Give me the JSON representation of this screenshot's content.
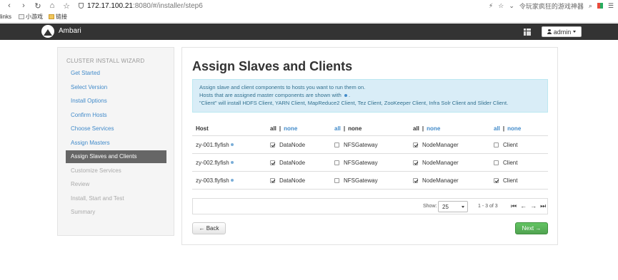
{
  "browser": {
    "back": "‹",
    "forward": "›",
    "reload": "↻",
    "home": "⌂",
    "star": "☆",
    "address_host": "172.17.100.21",
    "address_path": ":8080/#/installer/step6",
    "search_text": "令玩家疯狂的游戏神器"
  },
  "bookmarks": {
    "links_label": "links",
    "items": [
      "小游戏",
      "链接"
    ]
  },
  "header": {
    "brand": "Ambari",
    "user": "admin"
  },
  "sidebar": {
    "title": "CLUSTER INSTALL WIZARD",
    "items": [
      {
        "label": "Get Started",
        "state": "link"
      },
      {
        "label": "Select Version",
        "state": "link"
      },
      {
        "label": "Install Options",
        "state": "link"
      },
      {
        "label": "Confirm Hosts",
        "state": "link"
      },
      {
        "label": "Choose Services",
        "state": "link"
      },
      {
        "label": "Assign Masters",
        "state": "link"
      },
      {
        "label": "Assign Slaves and Clients",
        "state": "active"
      },
      {
        "label": "Customize Services",
        "state": "disabled"
      },
      {
        "label": "Review",
        "state": "disabled"
      },
      {
        "label": "Install, Start and Test",
        "state": "disabled"
      },
      {
        "label": "Summary",
        "state": "disabled"
      }
    ]
  },
  "main": {
    "title": "Assign Slaves and Clients",
    "info_line1": "Assign slave and client components to hosts you want to run them on.",
    "info_line2_a": "Hosts that are assigned master components are shown with",
    "info_line2_b": ".",
    "info_line3": "\"Client\" will install HDFS Client, YARN Client, MapReduce2 Client, Tez Client, ZooKeeper Client, Infra Solr Client and Slider Client.",
    "table": {
      "host_header": "Host",
      "all_label": "all",
      "none_label": "none",
      "sep": "|",
      "rows": [
        {
          "host": "zy-001.flyfish",
          "cells": [
            {
              "label": "DataNode",
              "checked": true
            },
            {
              "label": "NFSGateway",
              "checked": false
            },
            {
              "label": "NodeManager",
              "checked": true
            },
            {
              "label": "Client",
              "checked": false
            }
          ]
        },
        {
          "host": "zy-002.flyfish",
          "cells": [
            {
              "label": "DataNode",
              "checked": true
            },
            {
              "label": "NFSGateway",
              "checked": false
            },
            {
              "label": "NodeManager",
              "checked": true
            },
            {
              "label": "Client",
              "checked": false
            }
          ]
        },
        {
          "host": "zy-003.flyfish",
          "cells": [
            {
              "label": "DataNode",
              "checked": true
            },
            {
              "label": "NFSGateway",
              "checked": false
            },
            {
              "label": "NodeManager",
              "checked": true
            },
            {
              "label": "Client",
              "checked": true
            }
          ]
        }
      ]
    },
    "pager": {
      "show_label": "Show:",
      "page_size": "25",
      "range": "1 - 3 of 3"
    },
    "back_label": "← Back",
    "next_label": "Next →"
  },
  "colors": {
    "link": "#428bca",
    "active_nav": "#666666",
    "next_button": "#5cb85c"
  }
}
